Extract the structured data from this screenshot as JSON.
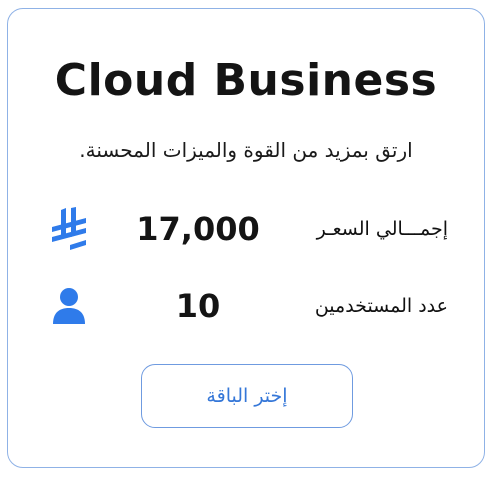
{
  "plan": {
    "title": "Cloud Business",
    "subtitle": "ارتق بمزيد من القوة والميزات المحسنة."
  },
  "price_row": {
    "icon": "riyal-currency-icon",
    "value": "17,000",
    "label": "إجمـــالي السعـر"
  },
  "users_row": {
    "icon": "user-icon",
    "value": "10",
    "label": "عدد المستخدمين"
  },
  "action": {
    "button_label": "إختر الباقة"
  },
  "colors": {
    "accent": "#3577d8",
    "icon_blue": "#2f7bea",
    "card_border": "#8fb2e6",
    "text": "#141414"
  }
}
